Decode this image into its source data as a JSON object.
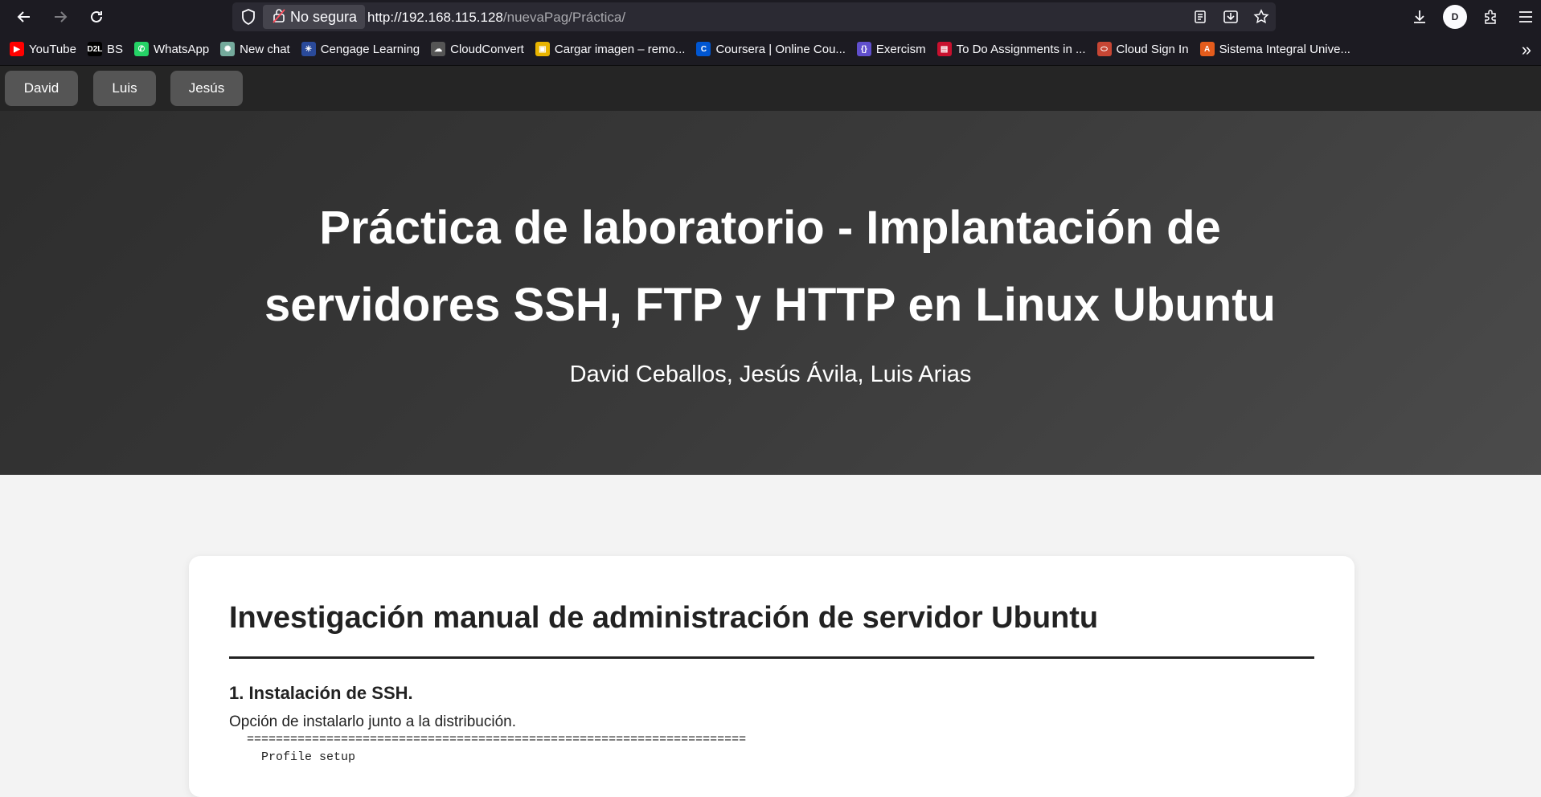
{
  "browser": {
    "security_label": "No segura",
    "url_host": "http://192.168.115.128",
    "url_path": "/nuevaPag/Práctica/",
    "icons": [
      "back-icon",
      "forward-icon",
      "reload-icon",
      "shield-icon",
      "lock-icon",
      "reader-view-icon",
      "save-page-icon",
      "star-icon",
      "download-icon",
      "account-avatar-icon",
      "extensions-icon",
      "menu-icon"
    ],
    "avatar_letter": "D"
  },
  "bookmarks": [
    {
      "label": "YouTube",
      "icon_text": "▶",
      "color": "#ff0000"
    },
    {
      "label": "BS",
      "icon_text": "D2L",
      "color": "#000000"
    },
    {
      "label": "WhatsApp",
      "icon_text": "✆",
      "color": "#25d366"
    },
    {
      "label": "New chat",
      "icon_text": "✺",
      "color": "#74aa9c"
    },
    {
      "label": "Cengage Learning",
      "icon_text": "✳",
      "color": "#2a4a9a"
    },
    {
      "label": "CloudConvert",
      "icon_text": "☁",
      "color": "#555555"
    },
    {
      "label": "Cargar imagen – remo...",
      "icon_text": "▣",
      "color": "#e8b400"
    },
    {
      "label": "Coursera | Online Cou...",
      "icon_text": "C",
      "color": "#0056d2"
    },
    {
      "label": "Exercism",
      "icon_text": "{}",
      "color": "#604fcd"
    },
    {
      "label": "To Do Assignments in ...",
      "icon_text": "▤",
      "color": "#c8102e"
    },
    {
      "label": "Cloud Sign In",
      "icon_text": "⬭",
      "color": "#c74634"
    },
    {
      "label": "Sistema Integral Unive...",
      "icon_text": "A",
      "color": "#e45c1c"
    }
  ],
  "site_nav": {
    "buttons": [
      "David",
      "Luis",
      "Jesús"
    ]
  },
  "hero": {
    "title": "Práctica de laboratorio - Implantación de servidores SSH, FTP y HTTP en Linux Ubuntu",
    "authors": "David Ceballos, Jesús Ávila, Luis Arias"
  },
  "content": {
    "heading": "Investigación manual de administración de servidor Ubuntu",
    "section_1_title": "1. Instalación de SSH.",
    "section_1_text": "Opción de instalarlo junto a la distribución.",
    "code_line_1": "=====================================================================",
    "code_line_2": "  Profile setup"
  }
}
